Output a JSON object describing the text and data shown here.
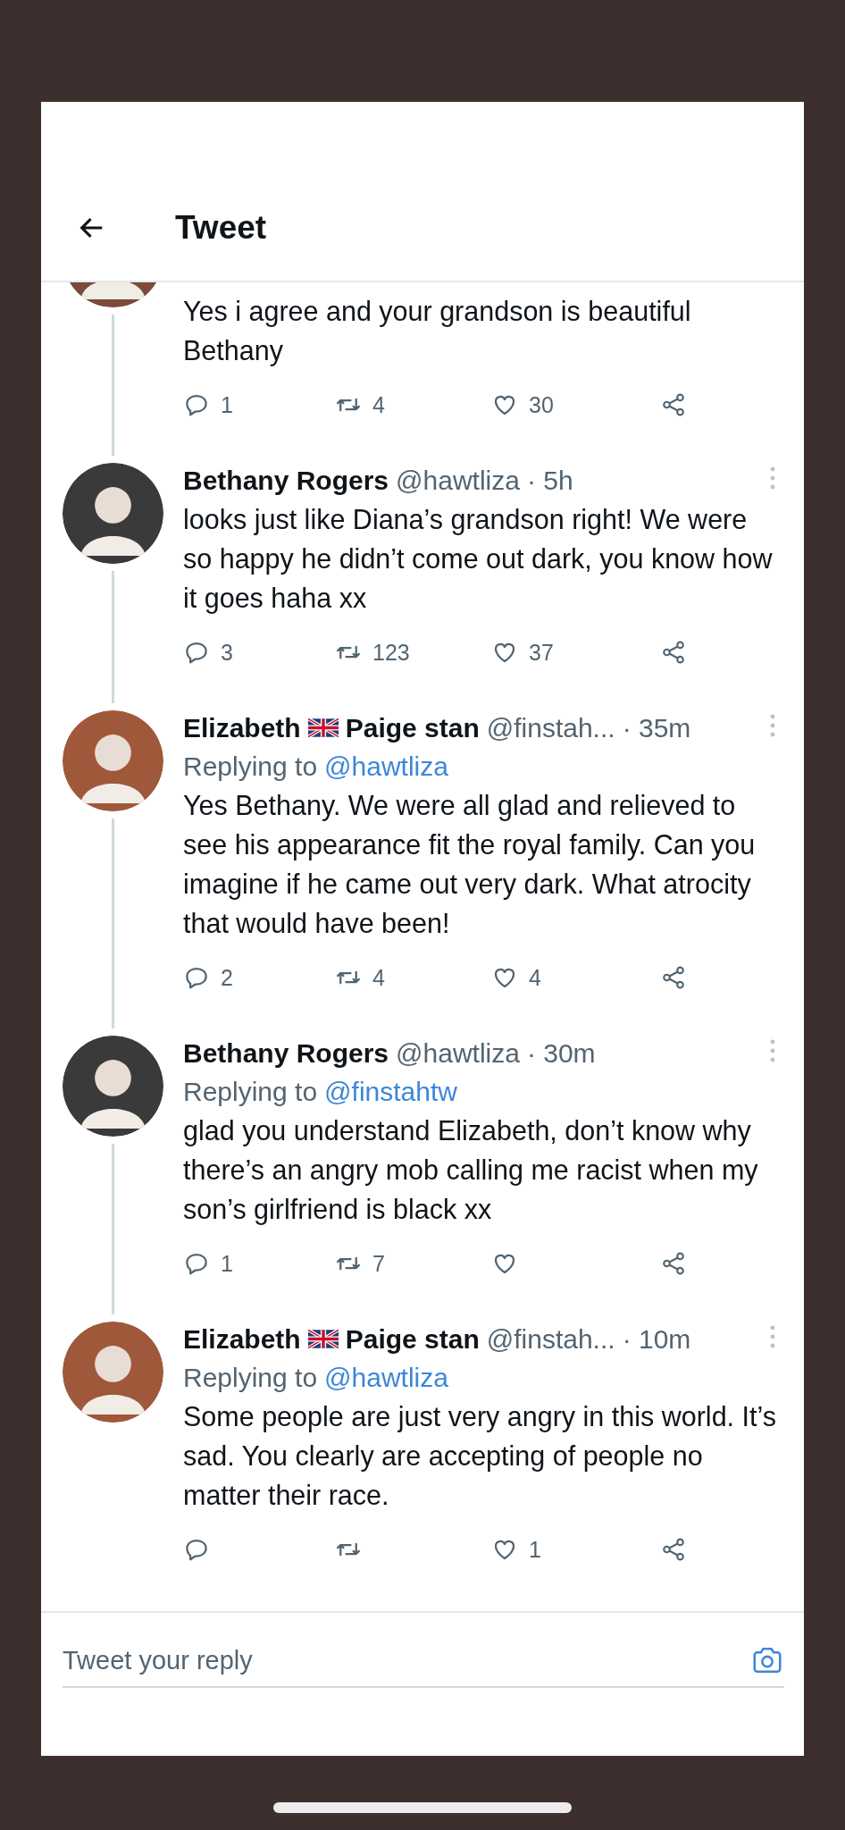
{
  "header": {
    "title": "Tweet"
  },
  "tweets": [
    {
      "cut": true,
      "color": "#7a4a3a",
      "text": "Yes i agree and your grandson is beautiful Bethany",
      "actions": {
        "replies": "1",
        "retweets": "4",
        "likes": "30"
      }
    },
    {
      "cut": false,
      "color": "#3a3a3a",
      "name": "Bethany Rogers",
      "handle": "@hawtliza",
      "time": "· 5h",
      "text": "looks just like Diana’s grandson right! We were so happy he didn’t come out dark, you know how it goes haha xx",
      "actions": {
        "replies": "3",
        "retweets": "123",
        "likes": "37"
      }
    },
    {
      "cut": false,
      "color": "#a0583a",
      "name": "Elizabeth",
      "flag": true,
      "name_suffix": "Paige stan",
      "handle": "@finstah...",
      "time": "· 35m",
      "replying_to": {
        "label": "Replying to",
        "handle": "@hawtliza"
      },
      "text": "Yes Bethany. We were all glad and relieved to see his appearance fit the royal family. Can you imagine if he came out very dark. What atrocity that would have been!",
      "actions": {
        "replies": "2",
        "retweets": "4",
        "likes": "4"
      }
    },
    {
      "cut": false,
      "color": "#3a3a3a",
      "name": "Bethany Rogers",
      "handle": "@hawtliza",
      "time": "· 30m",
      "replying_to": {
        "label": "Replying to",
        "handle": "@finstahtw"
      },
      "text": "glad you understand Elizabeth, don’t know why there’s an angry mob calling me racist when my son’s girlfriend is black xx",
      "actions": {
        "replies": "1",
        "retweets": "7"
      }
    },
    {
      "cut": false,
      "color": "#a0583a",
      "name": "Elizabeth",
      "flag": true,
      "name_suffix": "Paige stan",
      "handle": "@finstah...",
      "time": "· 10m",
      "replying_to": {
        "label": "Replying to",
        "handle": "@hawtliza"
      },
      "text": "Some people are just very angry in this world. It’s sad. You clearly are accepting of people no matter their race.",
      "actions": {
        "likes": "1"
      }
    }
  ],
  "reply_bar": {
    "placeholder": "Tweet your reply"
  }
}
